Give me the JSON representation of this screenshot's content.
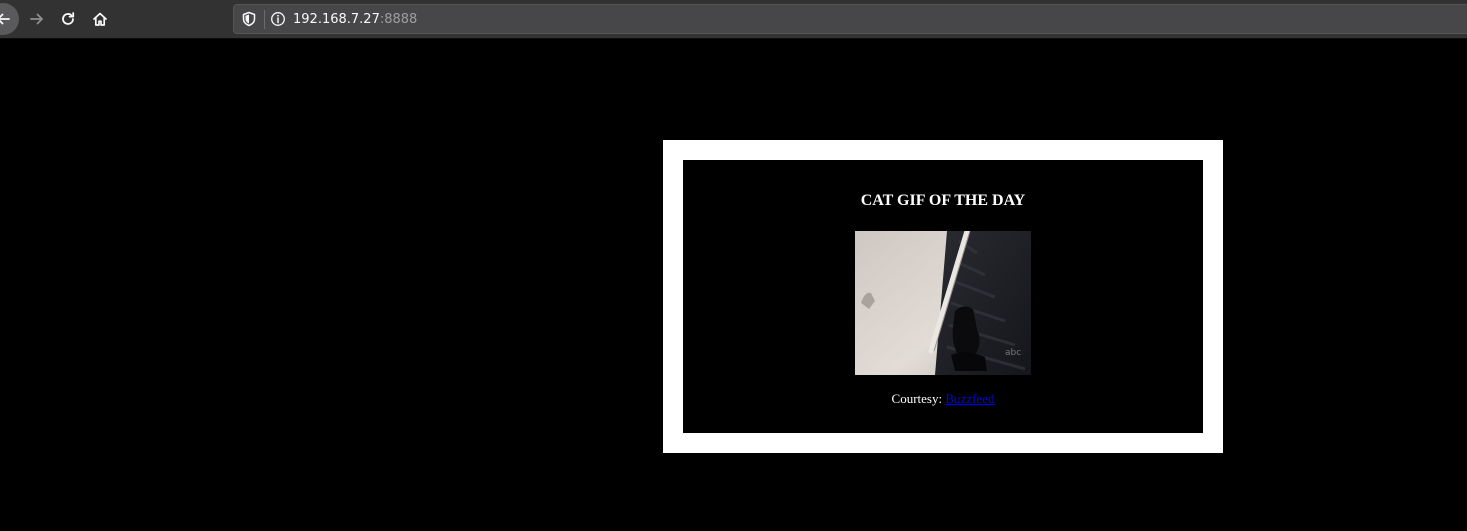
{
  "browser": {
    "url_host": "192.168.7.27",
    "url_port": ":8888"
  },
  "page": {
    "heading": "CAT GIF OF THE DAY",
    "image_alt": "cat gif",
    "courtesy_label": "Courtesy: ",
    "courtesy_link": "Buzzfeed",
    "link_color": "#0000ee",
    "frame_color": "#ffffff",
    "background_color": "#000000"
  },
  "icons": {
    "back": "arrow-left-icon",
    "forward": "arrow-right-icon",
    "reload": "reload-icon",
    "home": "home-icon",
    "tracking": "shield-icon",
    "site_info": "info-icon"
  }
}
